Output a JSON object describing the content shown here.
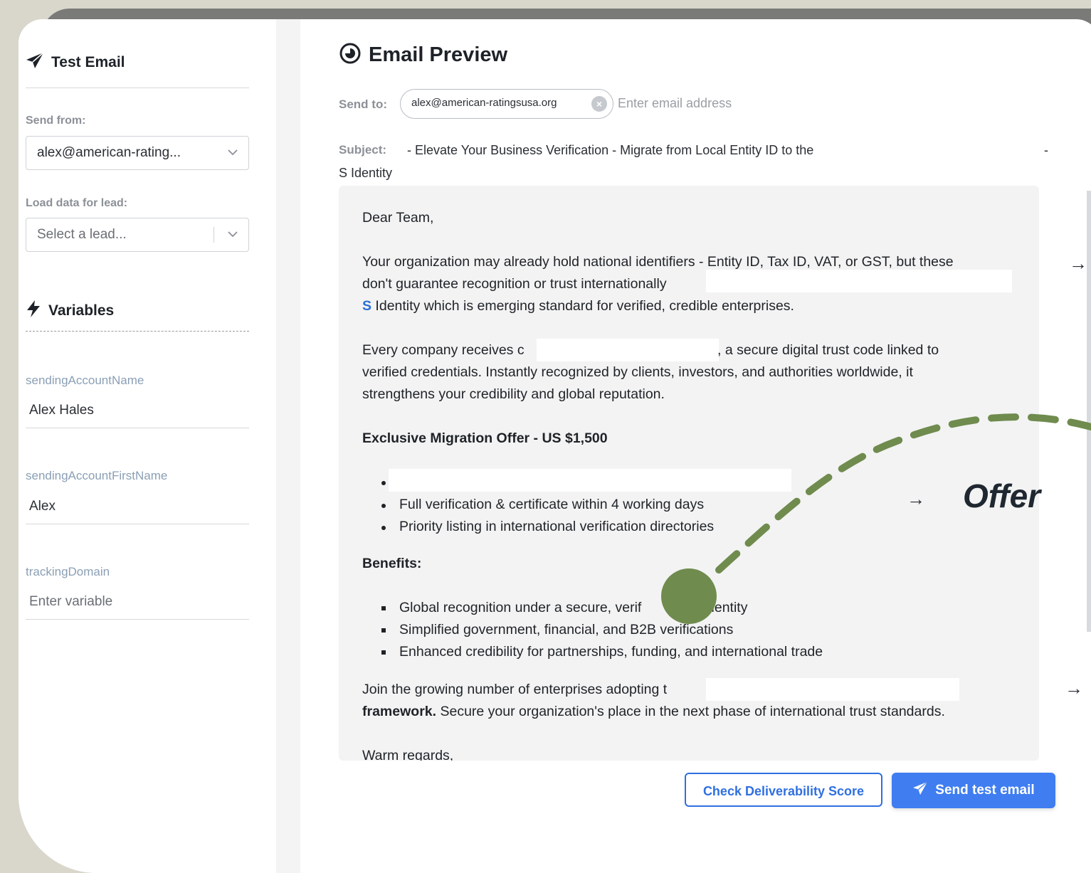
{
  "sidebar": {
    "title": "Test Email",
    "send_from_label": "Send from:",
    "send_from_value": "alex@american-rating...",
    "load_lead_label": "Load data for lead:",
    "load_lead_placeholder": "Select a lead...",
    "variables_title": "Variables",
    "variables": [
      {
        "name": "sendingAccountName",
        "value": "Alex Hales",
        "placeholder": ""
      },
      {
        "name": "sendingAccountFirstName",
        "value": "Alex",
        "placeholder": ""
      },
      {
        "name": "trackingDomain",
        "value": "",
        "placeholder": "Enter variable"
      }
    ]
  },
  "main": {
    "title": "Email Preview",
    "send_to_label": "Send to:",
    "recipient_chip": "alex@american-ratingsusa.org",
    "recipient_remove": "×",
    "email_placeholder": "Enter email address",
    "subject_label": "Subject:",
    "subject_line1": "- Elevate Your Business Verification - Migrate from Local Entity ID to the",
    "subject_tail": "-",
    "subject_line2": "S Identity",
    "body": {
      "greeting": "Dear Team,",
      "p1_line1": "Your organization may already hold national identifiers - Entity ID, Tax ID, VAT, or GST, but these",
      "p1_line2": "don't guarantee recognition or trust internationally",
      "p1_line3_highlight": "S",
      "p1_line3_rest": " Identity which is emerging standard for verified, credible enterprises.",
      "p2_line1a": "Every company receives c",
      "p2_line1b": ", a secure digital trust code linked to",
      "p2_line2": "verified credentials. Instantly recognized by clients, investors, and authorities worldwide, it",
      "p2_line3": "strengthens your credibility and global reputation.",
      "offer_heading": "Exclusive Migration Offer - US $1,500",
      "offer_items": [
        "",
        "Full verification & certificate within 4 working days",
        "Priority listing in international verification directories"
      ],
      "benefits_heading": "Benefits:",
      "benefit_items": [
        "Global recognition under a secure, verif",
        "Simplified government, financial, and B2B verifications",
        "Enhanced credibility for partnerships, funding, and international trade"
      ],
      "benefit1_tail": "dentity",
      "p3_line1": "Join the growing number of enterprises adopting t",
      "p3_line2_bold": "framework.",
      "p3_line2_rest": " Secure your organization's place in the next phase of international trust standards.",
      "closing": "Warm regards,"
    },
    "buttons": {
      "check": "Check Deliverability Score",
      "send": "Send test email"
    }
  },
  "annotation": {
    "offer_label": "Offer",
    "arrow": "→",
    "color": "#6f8b4e"
  }
}
